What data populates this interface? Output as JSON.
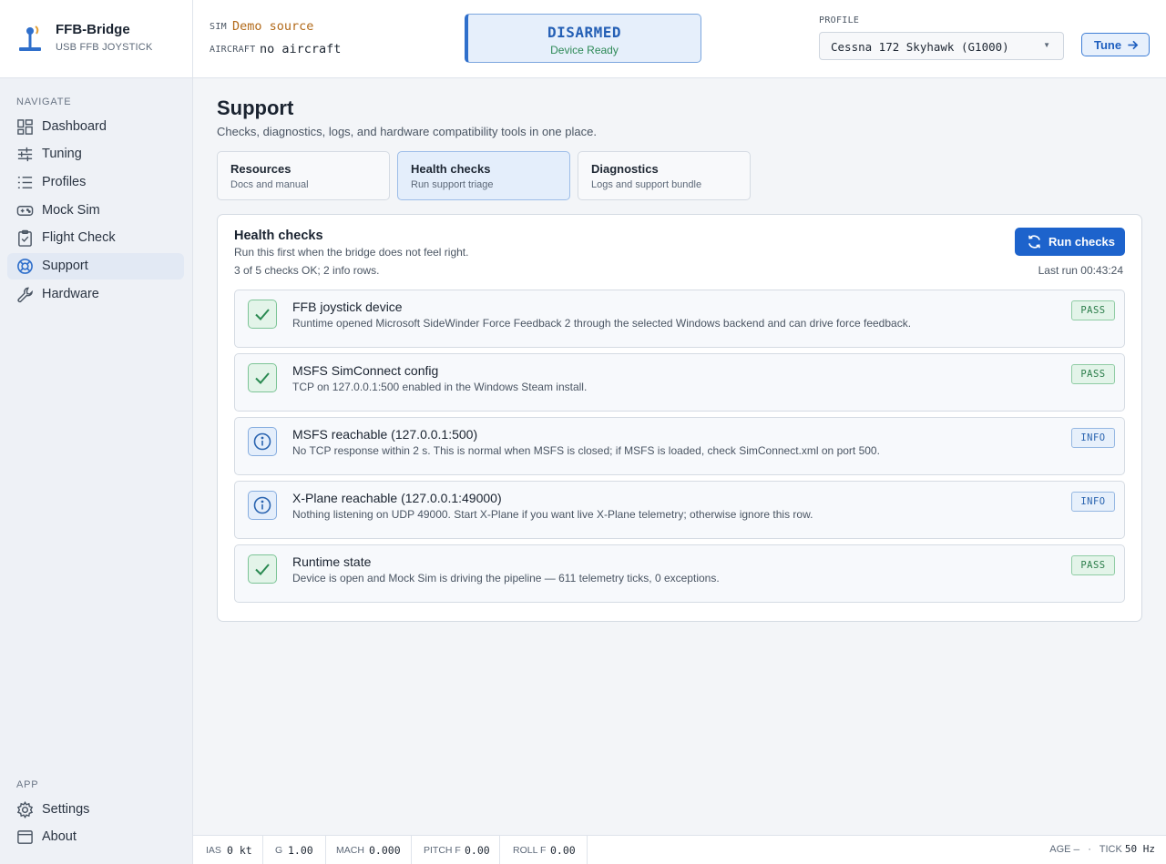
{
  "brand": {
    "title": "FFB-Bridge",
    "subtitle": "USB FFB JOYSTICK"
  },
  "nav": {
    "heading": "NAVIGATE",
    "items": [
      {
        "label": "Dashboard",
        "icon": "dashboard-icon"
      },
      {
        "label": "Tuning",
        "icon": "sliders-icon"
      },
      {
        "label": "Profiles",
        "icon": "list-icon"
      },
      {
        "label": "Mock Sim",
        "icon": "gamepad-icon"
      },
      {
        "label": "Flight Check",
        "icon": "clipboard-check-icon"
      },
      {
        "label": "Support",
        "icon": "lifebuoy-icon",
        "active": true
      },
      {
        "label": "Hardware",
        "icon": "wrench-icon"
      }
    ]
  },
  "app_nav": {
    "heading": "APP",
    "items": [
      {
        "label": "Settings",
        "icon": "gear-icon"
      },
      {
        "label": "About",
        "icon": "window-icon"
      }
    ]
  },
  "topbar": {
    "sim_key": "SIM",
    "sim_value": "Demo source",
    "aircraft_key": "AIRCRAFT",
    "aircraft_value": "no aircraft",
    "arm_state": "DISARMED",
    "arm_sub": "Device Ready",
    "profile_label": "PROFILE",
    "profile_value": "Cessna 172 Skyhawk (G1000)",
    "tune_label": "Tune"
  },
  "page": {
    "title": "Support",
    "description": "Checks, diagnostics, logs, and hardware compatibility tools in one place.",
    "tabs": [
      {
        "title": "Resources",
        "subtitle": "Docs and manual"
      },
      {
        "title": "Health checks",
        "subtitle": "Run support triage",
        "active": true
      },
      {
        "title": "Diagnostics",
        "subtitle": "Logs and support bundle"
      }
    ]
  },
  "health": {
    "title": "Health checks",
    "description": "Run this first when the bridge does not feel right.",
    "summary": "3 of 5 checks OK; 2 info rows.",
    "run_button": "Run checks",
    "last_run": "Last run 00:43:24",
    "checks": [
      {
        "name": "FFB joystick device",
        "desc": "Runtime opened Microsoft SideWinder Force Feedback 2 through the selected Windows backend and can drive force feedback.",
        "status": "PASS"
      },
      {
        "name": "MSFS SimConnect config",
        "desc": "TCP on 127.0.0.1:500 enabled in the Windows Steam install.",
        "status": "PASS"
      },
      {
        "name": "MSFS reachable (127.0.0.1:500)",
        "desc": "No TCP response within 2 s. This is normal when MSFS is closed; if MSFS is loaded, check SimConnect.xml on port 500.",
        "status": "INFO"
      },
      {
        "name": "X-Plane reachable (127.0.0.1:49000)",
        "desc": "Nothing listening on UDP 49000. Start X-Plane if you want live X-Plane telemetry; otherwise ignore this row.",
        "status": "INFO"
      },
      {
        "name": "Runtime state",
        "desc": "Device is open and Mock Sim is driving the pipeline — 611 telemetry ticks, 0 exceptions.",
        "status": "PASS"
      }
    ]
  },
  "statusbar": {
    "ias_key": "IAS",
    "ias_val": "0 kt",
    "g_key": "G",
    "g_val": "1.00",
    "mach_key": "MACH",
    "mach_val": "0.000",
    "pitch_key": "PITCH F",
    "pitch_val": "0.00",
    "roll_key": "ROLL F",
    "roll_val": "0.00",
    "age_key": "AGE",
    "age_val": "—",
    "tick_key": "TICK",
    "tick_val": "50 Hz"
  },
  "colors": {
    "accent": "#1d63cc",
    "pass": "#2b7d4a",
    "info": "#2a64b0",
    "sim_value": "#b26a1a"
  }
}
